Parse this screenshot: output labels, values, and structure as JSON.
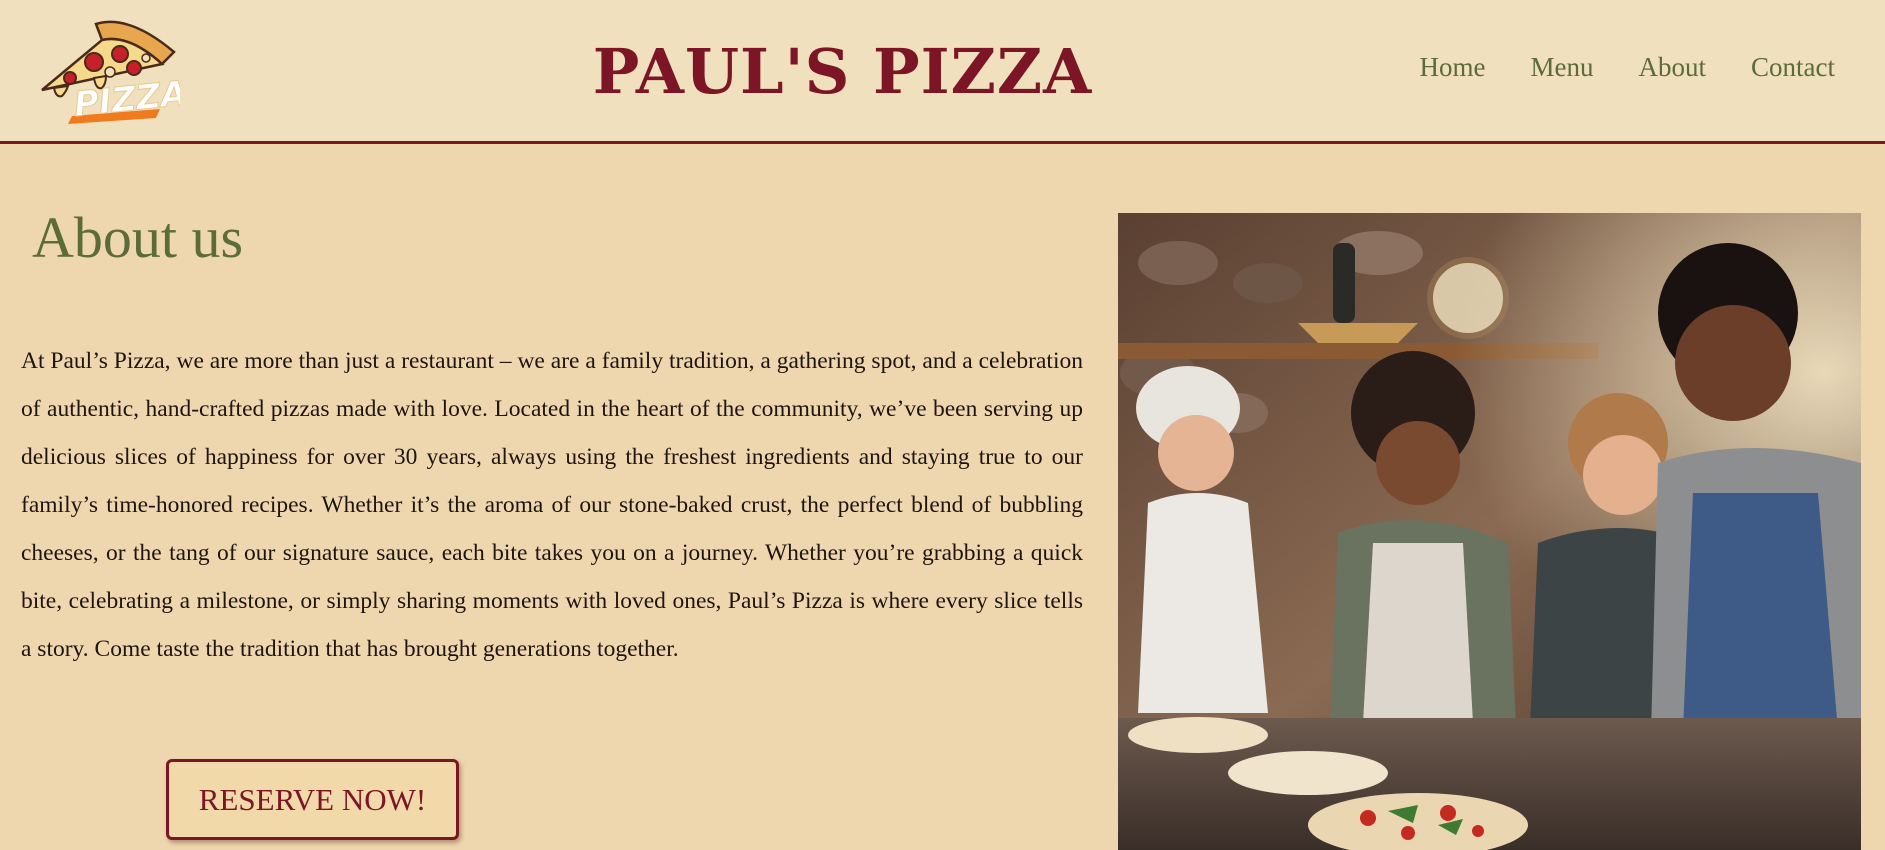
{
  "header": {
    "brand": "PAUL'S PIZZA",
    "logo_text": "PIZZA",
    "nav": [
      "Home",
      "Menu",
      "About",
      "Contact"
    ]
  },
  "about": {
    "title": "About us",
    "body": "At Paul’s Pizza, we are more than just a restaurant – we are a family tradition, a gathering spot, and a celebration of authentic, hand-crafted pizzas made with love. Located in the heart of the community, we’ve been serving up delicious slices of happiness for over 30 years, always using the freshest ingredients and staying true to our family’s time-honored recipes. Whether it’s the aroma of our stone-baked crust, the perfect blend of bubbling cheeses, or the tang of our signature sauce, each bite takes you on a journey. Whether you’re grabbing a quick bite, celebrating a milestone, or simply sharing moments with loved ones, Paul’s Pizza is where every slice tells a story. Come taste the tradition that has brought generations together.",
    "cta": "RESERVE NOW!"
  },
  "colors": {
    "accent": "#7c1626",
    "nav": "#5b6b3a",
    "background": "#eed7ae",
    "header_background": "#f1e0bd"
  }
}
